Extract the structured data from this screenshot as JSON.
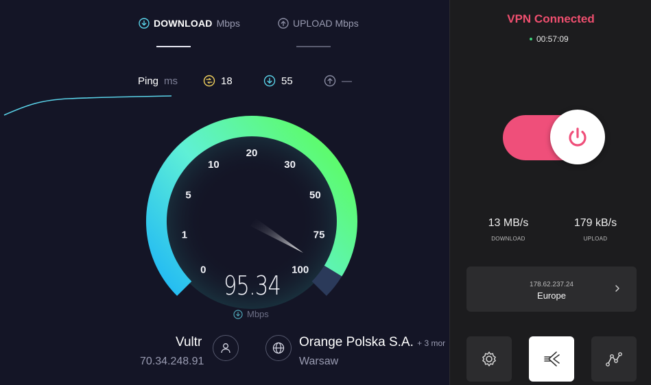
{
  "speedtest": {
    "tabs": [
      {
        "strong": "DOWNLOAD",
        "unit": "Mbps"
      },
      {
        "strong": "",
        "unit": "UPLOAD Mbps"
      }
    ],
    "ping": {
      "label": "Ping",
      "unit": "ms",
      "jitter": "18",
      "download": "55",
      "upload": "—"
    },
    "gauge": {
      "ticks": [
        "0",
        "1",
        "5",
        "10",
        "20",
        "30",
        "50",
        "75",
        "100"
      ],
      "reading": "95.34",
      "unit": "Mbps",
      "fraction_of_scale": 0.95
    },
    "server": {
      "name": "Vultr",
      "ip": "70.34.248.91"
    },
    "isp": {
      "name": "Orange Polska S.A.",
      "more": "+ 3 mor",
      "city": "Warsaw"
    },
    "colors": {
      "gauge_start": "#1fb7f5",
      "gauge_end": "#5dfb6e",
      "accent_cyan": "#5ad3e9",
      "jitter_yellow": "#f4d35e"
    }
  },
  "vpn": {
    "status": "VPN Connected",
    "timer": "00:57:09",
    "download": {
      "value": "13 MB/s",
      "label": "DOWNLOAD"
    },
    "upload": {
      "value": "179 kB/s",
      "label": "UPLOAD"
    },
    "server": {
      "ip": "178.62.237.24",
      "location": "Europe"
    },
    "buttons": [
      "settings-icon",
      "speedtest-icon",
      "network-icon"
    ],
    "colors": {
      "accent": "#ef4f6f",
      "toggle": "#ef4f7a"
    }
  }
}
